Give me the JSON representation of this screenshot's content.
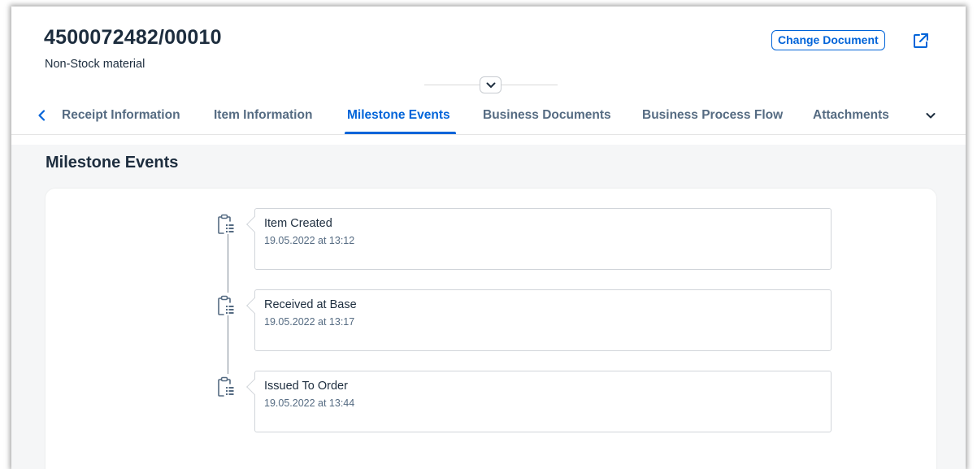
{
  "header": {
    "title": "4500072482/00010",
    "subtitle": "Non-Stock material",
    "change_document_label": "Change Document"
  },
  "tabs": [
    {
      "label": "Receipt Information",
      "active": false
    },
    {
      "label": "Item Information",
      "active": false
    },
    {
      "label": "Milestone Events",
      "active": true
    },
    {
      "label": "Business Documents",
      "active": false
    },
    {
      "label": "Business Process Flow",
      "active": false
    },
    {
      "label": "Attachments",
      "active": false
    }
  ],
  "section": {
    "title": "Milestone Events"
  },
  "milestones": [
    {
      "title": "Item Created",
      "timestamp": "19.05.2022 at 13:12",
      "icon": "clipboard-list-icon"
    },
    {
      "title": "Received at Base",
      "timestamp": "19.05.2022 at 13:17",
      "icon": "clipboard-list-icon"
    },
    {
      "title": "Issued To Order",
      "timestamp": "19.05.2022 at 13:44",
      "icon": "clipboard-list-icon"
    }
  ],
  "icons": {
    "share": "share-icon",
    "collapse": "chevron-down-icon",
    "tabs_prev": "chevron-left-icon",
    "tabs_more": "chevron-down-icon"
  },
  "colors": {
    "accent": "#0064d9",
    "text": "#1d2d3e",
    "muted": "#556b82",
    "background": "#f5f6f7"
  }
}
